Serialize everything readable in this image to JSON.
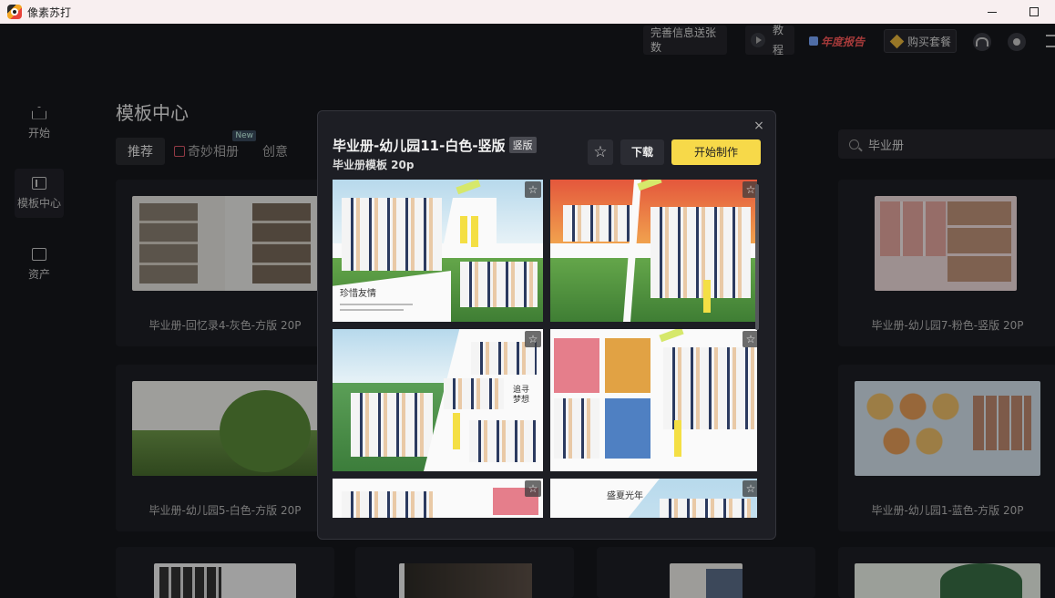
{
  "app": {
    "title": "像素苏打",
    "minimize": "",
    "maximize": ""
  },
  "topbar": {
    "info_button": "完善信息送张数",
    "tutorial_button": "教程",
    "annual_report": "年度报告",
    "buy_button": "购买套餐"
  },
  "sidebar": {
    "items": [
      {
        "label": "开始",
        "icon": "home-icon"
      },
      {
        "label": "模板中心",
        "icon": "template-icon"
      },
      {
        "label": "资产",
        "icon": "folder-icon"
      }
    ]
  },
  "main": {
    "title": "模板中心",
    "tabs": [
      {
        "label": "推荐"
      },
      {
        "label": "奇妙相册",
        "badge": "New"
      },
      {
        "label": "创意"
      }
    ],
    "search": {
      "value": "毕业册",
      "placeholder": ""
    },
    "cards": [
      {
        "title": "毕业册-回忆录4-灰色-方版 20P"
      },
      {
        "title": "毕业册-幼儿园7-粉色-竖版 20P"
      },
      {
        "title": "毕业册-幼儿园5-白色-方版 20P"
      },
      {
        "title": "毕业册-幼儿园1-蓝色-方版 20P"
      }
    ]
  },
  "dialog": {
    "title": "毕业册-幼儿园11-白色-竖版",
    "badge": "竖版",
    "subtitle": "毕业册模板 20p",
    "favorite_icon": "☆",
    "download_label": "下载",
    "start_label": "开始制作",
    "close_icon": "×",
    "page_texts": {
      "p1": "珍惜友情",
      "p3": "追寻梦想",
      "p6": "盛夏光年"
    }
  },
  "colors": {
    "accent": "#f7d949",
    "background": "#16171c",
    "dialog": "#1d1e24"
  }
}
